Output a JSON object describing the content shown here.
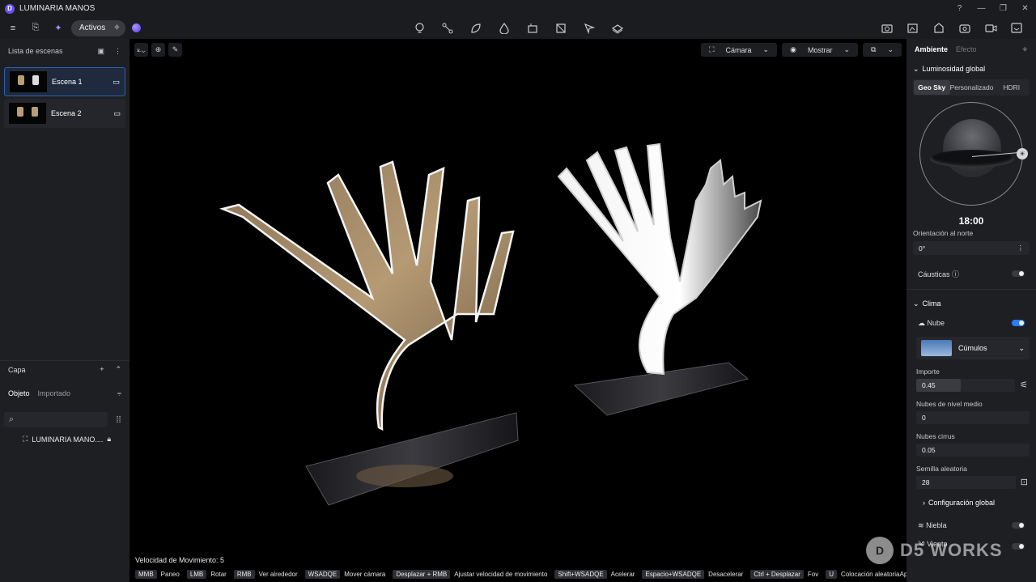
{
  "app": {
    "title": "LUMINARIA MANOS",
    "logo": "D"
  },
  "toolbar": {
    "assets_label": "Activos"
  },
  "scenes": {
    "header": "Lista de escenas",
    "items": [
      {
        "label": "Escena 1"
      },
      {
        "label": "Escena 2"
      }
    ]
  },
  "layers": {
    "header": "Capa"
  },
  "objects": {
    "tab_object": "Objeto",
    "tab_imported": "Importado",
    "item": "LUMINARIA MANO...."
  },
  "viewport": {
    "camera_label": "Cámara",
    "show_label": "Mostrar",
    "speed": "Velocidad de Movimiento: 5",
    "hints": [
      {
        "key": "MMB",
        "desc": "Paneo"
      },
      {
        "key": "LMB",
        "desc": "Rotar"
      },
      {
        "key": "RMB",
        "desc": "Ver alrededor"
      },
      {
        "key": "WSADQE",
        "desc": "Mover cámara"
      },
      {
        "key": "Desplazar + RMB",
        "desc": "Ajustar velocidad de movimiento"
      },
      {
        "key": "Shift+WSADQE",
        "desc": "Acelerar"
      },
      {
        "key": "Espacio+WSADQE",
        "desc": "Desacelerar"
      },
      {
        "key": "Ctrl + Desplazar",
        "desc": "Fov"
      },
      {
        "key": "U",
        "desc": "Colocación aleatoriaApagado"
      }
    ]
  },
  "panel": {
    "tab_ambient": "Ambiente",
    "tab_effect": "Efecto",
    "global_light": "Luminosidad global",
    "modes": [
      "Geo Sky",
      "Personalizado",
      "HDRI"
    ],
    "time": "18:00",
    "north_label": "Orientación al norte",
    "north_value": "0°",
    "caustics": "Cáusticas",
    "weather": "Clima",
    "cloud": "Nube",
    "cloud_type": "Cúmulos",
    "amount_label": "Importe",
    "amount_value": "0.45",
    "amount_fraction": 0.45,
    "mid_label": "Nubes de nivel medio",
    "mid_value": "0",
    "cirrus_label": "Nubes cirrus",
    "cirrus_value": "0.05",
    "seed_label": "Semilla aleatoria",
    "seed_value": "28",
    "global_config": "Configuración global",
    "fog": "Niebla",
    "wind": "Viento"
  },
  "watermark": "D5 WORKS",
  "colors": {
    "accent": "#2a7bff",
    "brand": "#6a4df0",
    "metal": "#b89f74"
  }
}
